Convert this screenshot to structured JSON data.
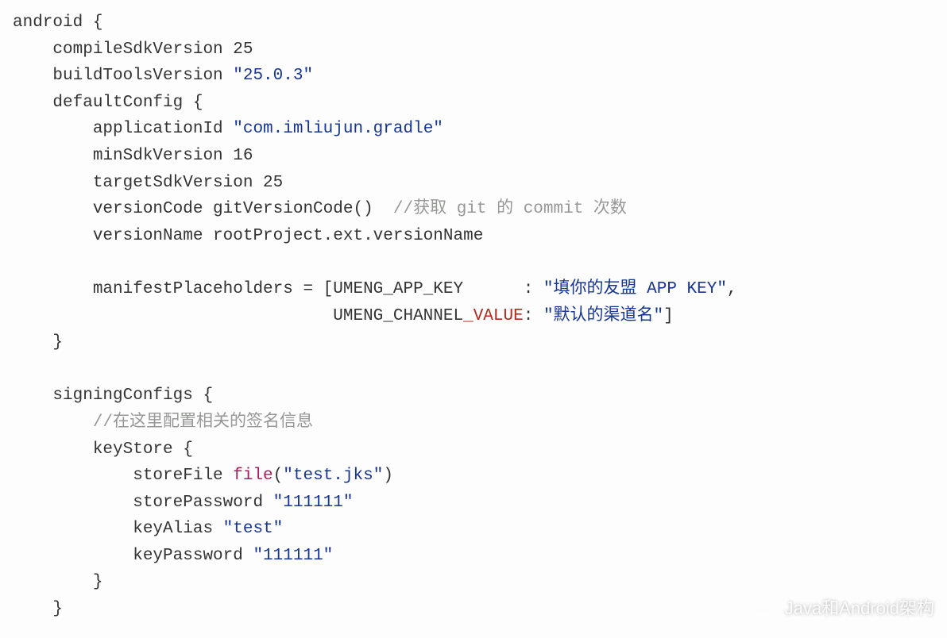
{
  "code": {
    "l01a": "android {",
    "l02a": "    compileSdkVersion 25",
    "l03a": "    buildToolsVersion ",
    "l03b": "\"25.0.3\"",
    "l04a": "    defaultConfig {",
    "l05a": "        applicationId ",
    "l05b": "\"com.imliujun.gradle\"",
    "l06a": "        minSdkVersion 16",
    "l07a": "        targetSdkVersion 25",
    "l08a": "        versionCode gitVersionCode()  ",
    "l08b": "//获取 git 的 commit 次数",
    "l09a": "        versionName rootProject.ext.versionName",
    "l10a": "",
    "l11a": "        manifestPlaceholders = [UMENG_APP_KEY      : ",
    "l11b": "\"填你的友盟 APP KEY\"",
    "l11c": ",",
    "l12a": "                                UMENG_CHANNEL",
    "l12x": "_VALUE",
    "l12b": ": ",
    "l12c": "\"默认的渠道名\"",
    "l12d": "]",
    "l13a": "    }",
    "l14a": "",
    "l15a": "    signingConfigs {",
    "l16a": "        ",
    "l16b": "//在这里配置相关的签名信息",
    "l17a": "        keyStore {",
    "l18a": "            storeFile ",
    "l18b": "file",
    "l18c": "(",
    "l18d": "\"test.jks\"",
    "l18e": ")",
    "l19a": "            storePassword ",
    "l19b": "\"111111\"",
    "l20a": "            keyAlias ",
    "l20b": "\"test\"",
    "l21a": "            keyPassword ",
    "l21b": "\"111111\"",
    "l22a": "        }",
    "l23a": "    }"
  },
  "watermark": "Java和Android架构"
}
